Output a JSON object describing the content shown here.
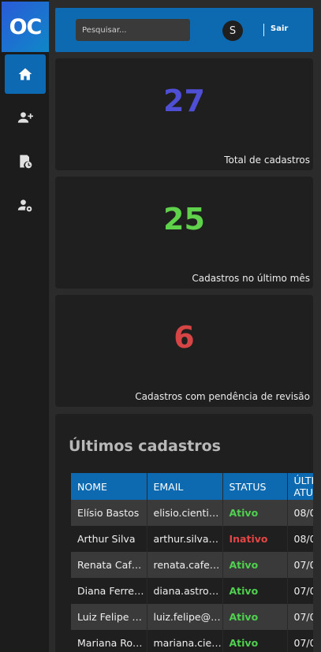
{
  "logo": {
    "text": "OC"
  },
  "sidebar": {
    "items": [
      {
        "icon": "home-icon"
      },
      {
        "icon": "add-user-icon"
      },
      {
        "icon": "document-history-icon"
      },
      {
        "icon": "user-settings-icon"
      }
    ]
  },
  "header": {
    "search_placeholder": "Pesquisar...",
    "avatar_initial": "S",
    "logout_label": "Sair"
  },
  "stats": [
    {
      "value": "27",
      "label": "Total de cadastros",
      "color": "#4f4fd6"
    },
    {
      "value": "25",
      "label": "Cadastros no último mês",
      "color": "#5fd14a"
    },
    {
      "value": "6",
      "label": "Cadastros com pendência de revisão",
      "color": "#d64545"
    }
  ],
  "recent": {
    "title": "Últimos cadastros",
    "columns": [
      "NOME",
      "EMAIL",
      "STATUS",
      "ÚLTIMA ATUALIZAÇÃO"
    ],
    "rows": [
      {
        "name": "Elísio Bastos",
        "email": "elisio.cientista@email.com",
        "status": "Ativo",
        "date": "08/0"
      },
      {
        "name": "Arthur Silva",
        "email": "arthur.silva@email.com",
        "status": "Inativo",
        "date": "08/0"
      },
      {
        "name": "Renata Cafeteira",
        "email": "renata.cafeteira@email.com",
        "status": "Ativo",
        "date": "07/0"
      },
      {
        "name": "Diana Ferreira",
        "email": "diana.astronauta@email.com",
        "status": "Ativo",
        "date": "07/0"
      },
      {
        "name": "Luiz Felipe Souza",
        "email": "luiz.felipe@email.com",
        "status": "Ativo",
        "date": "07/0"
      },
      {
        "name": "Mariana Rocha",
        "email": "mariana.cientista@email.com",
        "status": "Ativo",
        "date": "07/0"
      }
    ]
  }
}
